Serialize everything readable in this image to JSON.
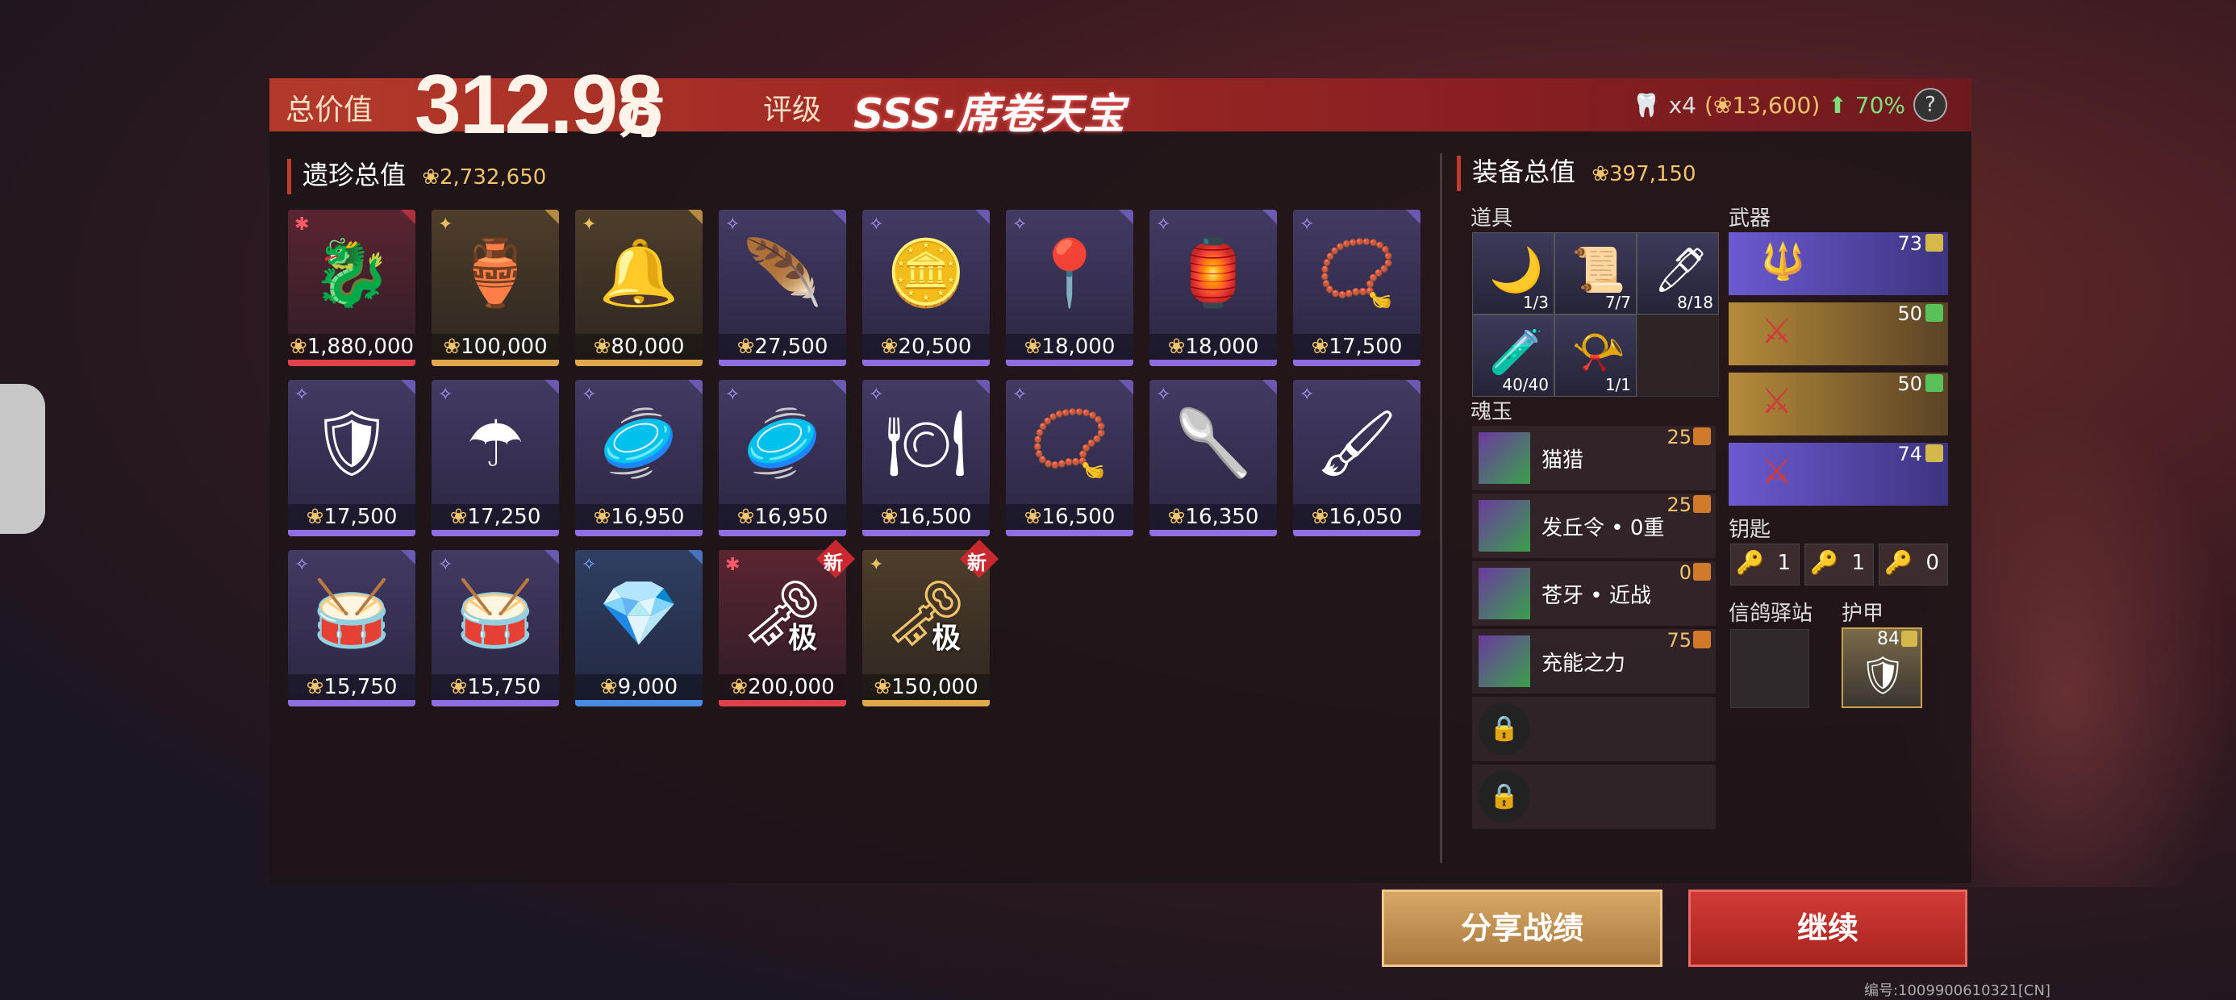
{
  "header": {
    "total_label": "总价值",
    "total_value": "312.98",
    "total_unit": "万",
    "rank_label": "评级",
    "rank_value": "SSS·席卷天宝",
    "tooth_count": "x4",
    "tooth_value_open": "(",
    "tooth_value": "13,600",
    "tooth_value_close": ")",
    "bonus": "70%",
    "help": "?"
  },
  "relics": {
    "title": "遗珍总值",
    "value": "2,732,650",
    "items": [
      {
        "icon": "dragon-seal-icon",
        "rarity": "red",
        "price": "1,880,000"
      },
      {
        "icon": "incense-burner-icon",
        "rarity": "gold",
        "price": "100,000"
      },
      {
        "icon": "bell-icon",
        "rarity": "gold",
        "price": "80,000"
      },
      {
        "icon": "feather-icon",
        "rarity": "purple",
        "price": "27,500"
      },
      {
        "icon": "gold-ingots-icon",
        "rarity": "purple",
        "price": "20,500"
      },
      {
        "icon": "hairpin-icon",
        "rarity": "purple",
        "price": "18,000"
      },
      {
        "icon": "lantern-icon",
        "rarity": "purple",
        "price": "18,000"
      },
      {
        "icon": "tooth-necklace-icon",
        "rarity": "purple",
        "price": "17,500"
      },
      {
        "icon": "shield-disc-icon",
        "rarity": "purple",
        "price": "17,500"
      },
      {
        "icon": "umbrella-icon",
        "rarity": "purple",
        "price": "17,250"
      },
      {
        "icon": "cymbal-icon",
        "rarity": "purple",
        "price": "16,950"
      },
      {
        "icon": "cymbal-icon",
        "rarity": "purple",
        "price": "16,950"
      },
      {
        "icon": "gold-plate-icon",
        "rarity": "purple",
        "price": "16,500"
      },
      {
        "icon": "bead-necklace-icon",
        "rarity": "purple",
        "price": "16,500"
      },
      {
        "icon": "ladle-icon",
        "rarity": "purple",
        "price": "16,350"
      },
      {
        "icon": "porcelain-brush-icon",
        "rarity": "purple",
        "price": "16,050"
      },
      {
        "icon": "drum-icon",
        "rarity": "purple",
        "price": "15,750"
      },
      {
        "icon": "drum-icon",
        "rarity": "purple",
        "price": "15,750"
      },
      {
        "icon": "red-crystal-icon",
        "rarity": "blue",
        "price": "9,000"
      },
      {
        "icon": "gold-key-icon",
        "rarity": "red",
        "price": "200,000",
        "new": "新",
        "tag": "极"
      },
      {
        "icon": "jade-key-icon",
        "rarity": "gold",
        "price": "150,000",
        "new": "新",
        "tag": "极"
      }
    ]
  },
  "equipment": {
    "title": "装备总值",
    "value": "397,150",
    "tools_label": "道具",
    "tools": [
      {
        "icon": "crescent-icon",
        "count": "1/3"
      },
      {
        "icon": "green-scroll-icon",
        "count": "7/7"
      },
      {
        "icon": "pen-icon",
        "count": "8/18"
      },
      {
        "icon": "potion-icon",
        "count": "40/40"
      },
      {
        "icon": "trumpet-icon",
        "count": "1/1"
      }
    ],
    "soul_label": "魂玉",
    "souls": [
      {
        "name": "猫猎",
        "level": "25"
      },
      {
        "name": "发丘令 • 0重",
        "level": "25"
      },
      {
        "name": "苍牙 • 近战",
        "level": "0"
      },
      {
        "name": "充能之力",
        "level": "75"
      }
    ],
    "weapons_label": "武器",
    "weapons": [
      {
        "icon": "spear-icon",
        "level": "73",
        "rarity": "purple"
      },
      {
        "icon": "red-blade-icon",
        "level": "50",
        "rarity": "gold"
      },
      {
        "icon": "red-blade-icon",
        "level": "50",
        "rarity": "gold"
      },
      {
        "icon": "blue-blade-icon",
        "level": "74",
        "rarity": "purple"
      }
    ],
    "keys_label": "钥匙",
    "keys": [
      {
        "icon": "key-gold-icon",
        "count": "1"
      },
      {
        "icon": "key-red-icon",
        "count": "1"
      },
      {
        "icon": "key-orange-icon",
        "count": "0"
      }
    ],
    "pigeon_label": "信鸽驿站",
    "armor_label": "护甲",
    "armor_level": "84"
  },
  "buttons": {
    "share": "分享战绩",
    "continue": "继续"
  },
  "serial": "编号:1009900610321[CN]"
}
